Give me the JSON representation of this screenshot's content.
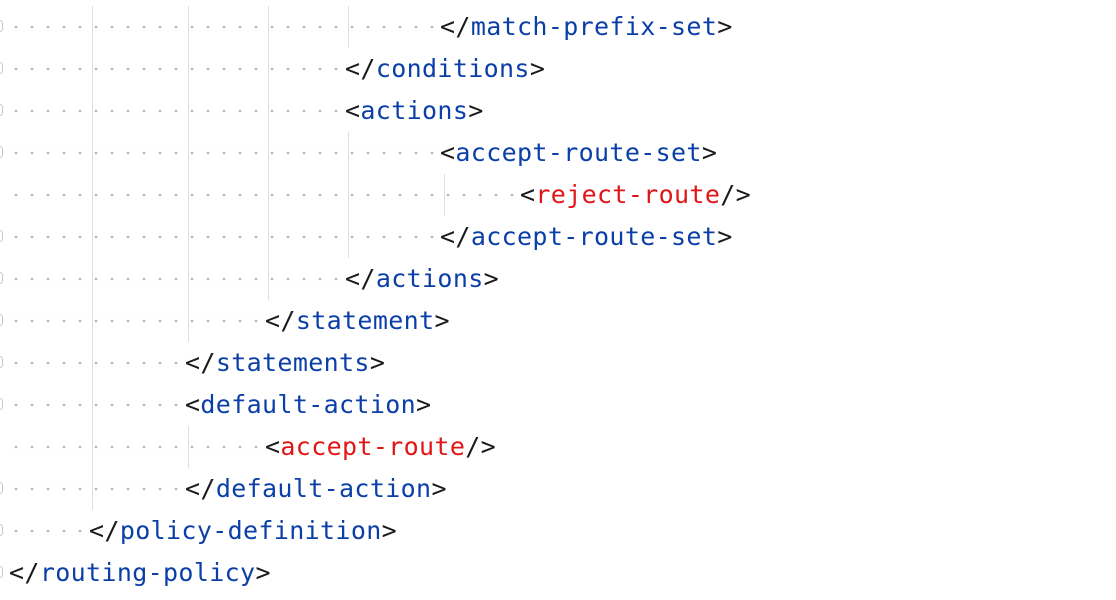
{
  "editor": {
    "language": "xml",
    "lines": [
      {
        "open": "</",
        "tag": "match-prefix-set",
        "close": ">",
        "tag_color": "#0b3fa8"
      },
      {
        "open": "</",
        "tag": "conditions",
        "close": ">",
        "tag_color": "#0b3fa8"
      },
      {
        "open": "<",
        "tag": "actions",
        "close": ">",
        "tag_color": "#0b3fa8"
      },
      {
        "open": "<",
        "tag": "accept-route-set",
        "close": ">",
        "tag_color": "#0b3fa8"
      },
      {
        "open": "<",
        "tag": "reject-route",
        "close": "/>",
        "tag_color": "#e01616"
      },
      {
        "open": "</",
        "tag": "accept-route-set",
        "close": ">",
        "tag_color": "#0b3fa8"
      },
      {
        "open": "</",
        "tag": "actions",
        "close": ">",
        "tag_color": "#0b3fa8"
      },
      {
        "open": "</",
        "tag": "statement",
        "close": ">",
        "tag_color": "#0b3fa8"
      },
      {
        "open": "</",
        "tag": "statements",
        "close": ">",
        "tag_color": "#0b3fa8"
      },
      {
        "open": "<",
        "tag": "default-action",
        "close": ">",
        "tag_color": "#0b3fa8"
      },
      {
        "open": "<",
        "tag": "accept-route",
        "close": "/>",
        "tag_color": "#e01616"
      },
      {
        "open": "</",
        "tag": "default-action",
        "close": ">",
        "tag_color": "#0b3fa8"
      },
      {
        "open": "</",
        "tag": "policy-definition",
        "close": ">",
        "tag_color": "#0b3fa8"
      },
      {
        "open": "</",
        "tag": "routing-policy",
        "close": ">",
        "tag_color": "#0b3fa8"
      }
    ]
  },
  "colors": {
    "background": "#ffffff",
    "bracket": "#1a1a1a",
    "tag": "#0b3fa8",
    "tag_self_closing": "#e01616",
    "whitespace_dot": "#b9b9b9",
    "indent_guide": "#dedede",
    "fold_marker": "#c8c8c8"
  }
}
